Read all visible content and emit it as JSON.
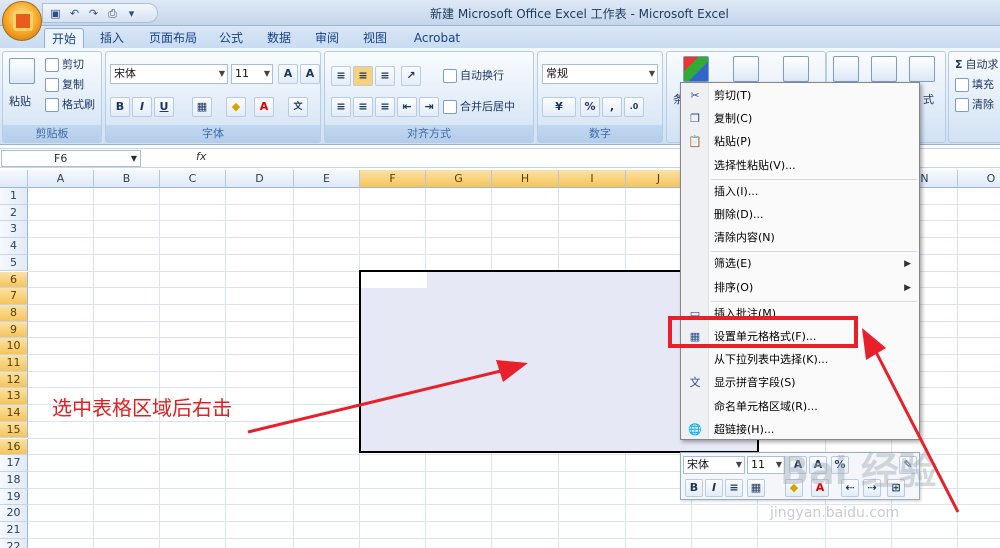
{
  "window": {
    "title": "新建 Microsoft Office Excel 工作表 - Microsoft Excel"
  },
  "tabs": [
    "开始",
    "插入",
    "页面布局",
    "公式",
    "数据",
    "审阅",
    "视图",
    "Acrobat"
  ],
  "ribbon": {
    "clipboard": {
      "paste": "粘贴",
      "cut": "剪切",
      "copy": "复制",
      "format_painter": "格式刷",
      "label": "剪贴板"
    },
    "font": {
      "name": "宋体",
      "size": "11",
      "bold": "B",
      "italic": "I",
      "underline": "U",
      "label": "字体"
    },
    "alignment": {
      "wrap": "自动换行",
      "merge": "合并后居中",
      "label": "对齐方式"
    },
    "number": {
      "format": "常规",
      "percent": "%",
      "label": "数字"
    },
    "styles": {
      "cond": "条"
    },
    "cells": {
      "format": "式"
    },
    "editing": {
      "autosum": "自动求",
      "fill": "填充",
      "clear": "清除"
    }
  },
  "formula_bar": {
    "name_box": "F6",
    "fx": "fx",
    "value": ""
  },
  "columns": [
    "A",
    "B",
    "C",
    "D",
    "E",
    "F",
    "G",
    "H",
    "I",
    "J",
    "K",
    "L",
    "M",
    "N",
    "O"
  ],
  "rows": [
    "1",
    "2",
    "3",
    "4",
    "5",
    "6",
    "7",
    "8",
    "9",
    "10",
    "11",
    "12",
    "13",
    "14",
    "15",
    "16",
    "17",
    "18",
    "19",
    "20",
    "21",
    "22"
  ],
  "context_menu": [
    {
      "label": "剪切(T)",
      "icon": "scissors-icon",
      "glyph": "✂"
    },
    {
      "label": "复制(C)",
      "icon": "copy-icon",
      "glyph": "❐"
    },
    {
      "label": "粘贴(P)",
      "icon": "paste-icon",
      "glyph": "📋"
    },
    {
      "label": "选择性粘贴(V)..."
    },
    {
      "sep": true
    },
    {
      "label": "插入(I)..."
    },
    {
      "label": "删除(D)..."
    },
    {
      "label": "清除内容(N)"
    },
    {
      "sep": true
    },
    {
      "label": "筛选(E)",
      "submenu": true
    },
    {
      "label": "排序(O)",
      "submenu": true
    },
    {
      "sep": true
    },
    {
      "label": "插入批注(M)",
      "icon": "comment-icon",
      "glyph": "▭"
    },
    {
      "label": "设置单元格格式(F)...",
      "icon": "format-cells-icon",
      "glyph": "▦"
    },
    {
      "label": "从下拉列表中选择(K)..."
    },
    {
      "label": "显示拼音字段(S)",
      "icon": "phonetic-icon",
      "glyph": "文"
    },
    {
      "label": "命名单元格区域(R)..."
    },
    {
      "label": "超链接(H)...",
      "icon": "hyperlink-icon",
      "glyph": "🌐"
    }
  ],
  "mini_toolbar": {
    "font": "宋体",
    "size": "11",
    "bold": "B",
    "italic": "I",
    "percent": "%"
  },
  "annotation": "选中表格区域后右击",
  "watermark": {
    "text": "Bai 经验",
    "url": "jingyan.baidu.com"
  },
  "colors": {
    "highlight": "#e8202a",
    "selection": "#e6e8f5",
    "ribbon": "#dbe8f6"
  }
}
